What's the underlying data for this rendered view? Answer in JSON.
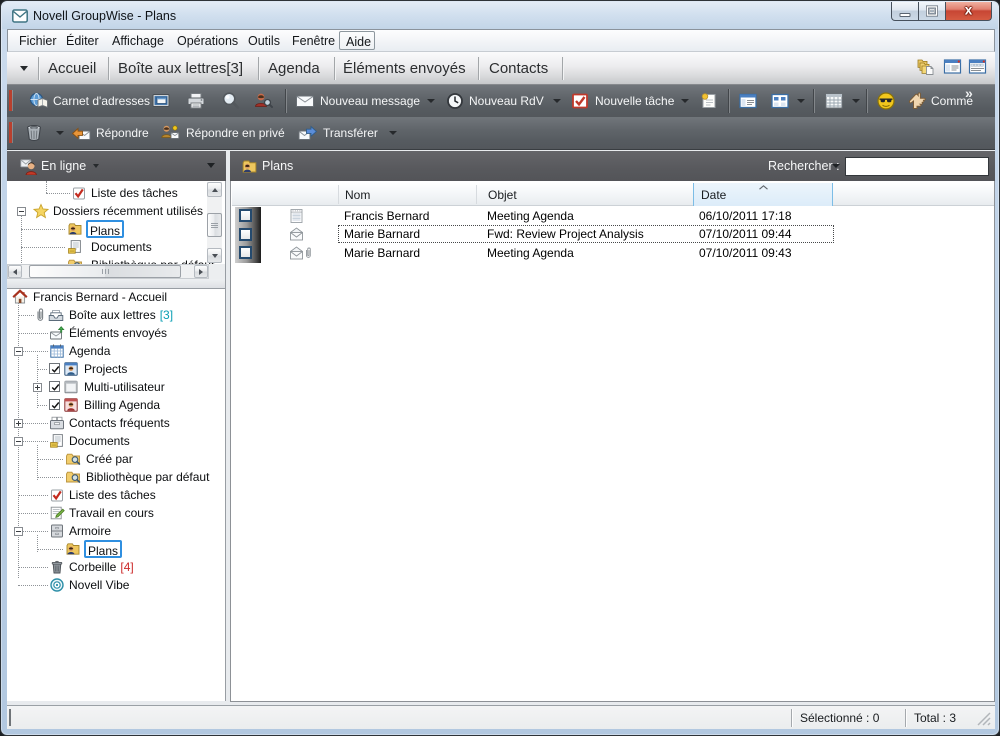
{
  "window": {
    "title": "Novell GroupWise - Plans",
    "app_icon": "envelope-app",
    "controls": {
      "minimize": "minimize",
      "maximize": "maximize",
      "close": "close"
    }
  },
  "colors": {
    "close_button": "#c74634",
    "selection_border": "#2f8fe0",
    "mailbox_count": "#0a9fb4",
    "trash_count": "#cc2b2b",
    "toolbar_bg": "#5a5e63",
    "titlebar_bg": "#cddcee"
  },
  "menu": {
    "items": [
      {
        "label": "Fichier"
      },
      {
        "label": "Éditer"
      },
      {
        "label": "Affichage"
      },
      {
        "label": "Opérations"
      },
      {
        "label": "Outils"
      },
      {
        "label": "Fenêtre"
      },
      {
        "label": "Aide",
        "focused": true
      }
    ]
  },
  "tabs": {
    "dropdown_icon": "caret-down",
    "items": [
      {
        "label": "Accueil"
      },
      {
        "label": "Boîte aux lettres[3]"
      },
      {
        "label": "Agenda"
      },
      {
        "label": "Éléments envoyés"
      },
      {
        "label": "Contacts"
      }
    ],
    "right_icons": [
      {
        "icon": "folders-stack"
      },
      {
        "icon": "window-panel"
      },
      {
        "icon": "window-grid"
      }
    ]
  },
  "toolbar_main": {
    "address_book": {
      "label": "Carnet d'adresses",
      "icon": "address-book"
    },
    "properties": {
      "icon": "properties-window"
    },
    "print": {
      "icon": "printer"
    },
    "search": {
      "icon": "magnifier"
    },
    "find_user": {
      "icon": "user-magnifier"
    },
    "new_message": {
      "label": "Nouveau message",
      "icon": "envelope"
    },
    "new_appointment": {
      "label": "Nouveau RdV",
      "icon": "clock"
    },
    "new_task": {
      "label": "Nouvelle tâche",
      "icon": "task-check-red"
    },
    "new_note": {
      "icon": "sticky-note"
    },
    "panel_1": {
      "icon": "panel-window"
    },
    "panel_2": {
      "icon": "panel-grid"
    },
    "calendar_view": {
      "icon": "calendar-grid"
    },
    "notify": {
      "icon": "notify-sunglasses"
    },
    "comment": {
      "label": "Comme",
      "icon": "hand"
    },
    "overflow_chevron": "»"
  },
  "toolbar_message": {
    "delete": {
      "icon": "trash-3d"
    },
    "reply": {
      "label": "Répondre",
      "icon": "reply-arrow"
    },
    "reply_private": {
      "label": "Répondre en privé",
      "icon": "reply-private"
    },
    "forward": {
      "label": "Transférer",
      "icon": "forward-arrow"
    }
  },
  "left_panel": {
    "online_header": {
      "label": "En ligne",
      "icon": "online-user"
    },
    "minitree": {
      "items": [
        {
          "label": "Liste des tâches",
          "icon": "task-check"
        },
        {
          "label": "Dossiers récemment utilisés",
          "icon": "star",
          "expander": "minus"
        },
        {
          "label": "Plans",
          "icon": "folder-user",
          "selected": true
        },
        {
          "label": "Documents",
          "icon": "documents"
        },
        {
          "label": "Bibliothèque par défaut",
          "icon": "folder-search"
        }
      ]
    },
    "maintree": {
      "items": [
        {
          "label": "Francis Bernard - Accueil",
          "icon": "house"
        },
        {
          "label": "Boîte aux lettres",
          "count": "[3]",
          "icon": "mailbox",
          "prefix_icon": "paperclip"
        },
        {
          "label": "Éléments envoyés",
          "icon": "sent-items"
        },
        {
          "label": "Agenda",
          "icon": "calendar",
          "expander": "minus"
        },
        {
          "label": "Projects",
          "icon": "calendar-user-blue",
          "checked": true
        },
        {
          "label": "Multi-utilisateur",
          "icon": "window-gray",
          "checked": true,
          "expander": "plus"
        },
        {
          "label": "Billing Agenda",
          "icon": "calendar-user-red",
          "checked": true
        },
        {
          "label": "Contacts fréquents",
          "icon": "card-file",
          "expander": "plus"
        },
        {
          "label": "Documents",
          "icon": "documents",
          "expander": "minus"
        },
        {
          "label": "Créé par",
          "icon": "folder-search"
        },
        {
          "label": "Bibliothèque par défaut",
          "icon": "folder-search"
        },
        {
          "label": "Liste des tâches",
          "icon": "task-check"
        },
        {
          "label": "Travail en cours",
          "icon": "work-in-progress"
        },
        {
          "label": "Armoire",
          "icon": "cabinet",
          "expander": "minus"
        },
        {
          "label": "Plans",
          "icon": "folder-user",
          "selected": true
        },
        {
          "label": "Corbeille",
          "count": "[4]",
          "icon": "trash"
        },
        {
          "label": "Novell Vibe",
          "icon": "vibe-rings"
        }
      ]
    }
  },
  "list_panel": {
    "header": {
      "label": "Plans",
      "icon": "folder-user"
    },
    "search": {
      "label": "Rechercher :",
      "value": "",
      "dropdown_icon": "caret-down"
    },
    "columns": [
      {
        "label": "Nom"
      },
      {
        "label": "Objet"
      },
      {
        "label": "Date",
        "sorted": "ascending"
      }
    ],
    "rows": [
      {
        "icon": "memo-page",
        "name": "Francis Bernard",
        "subject": "Meeting Agenda",
        "date": "06/10/2011 17:18"
      },
      {
        "icon": "envelope-open",
        "name": "Marie Barnard",
        "subject": "Fwd: Review Project Analysis",
        "date": "07/10/2011 09:44",
        "selected": true
      },
      {
        "icon": "envelope-open-clip",
        "name": "Marie Barnard",
        "subject": "Meeting Agenda",
        "date": "07/10/2011 09:43"
      }
    ]
  },
  "statusbar": {
    "selected": "Sélectionné : 0",
    "total": "Total : 3"
  }
}
